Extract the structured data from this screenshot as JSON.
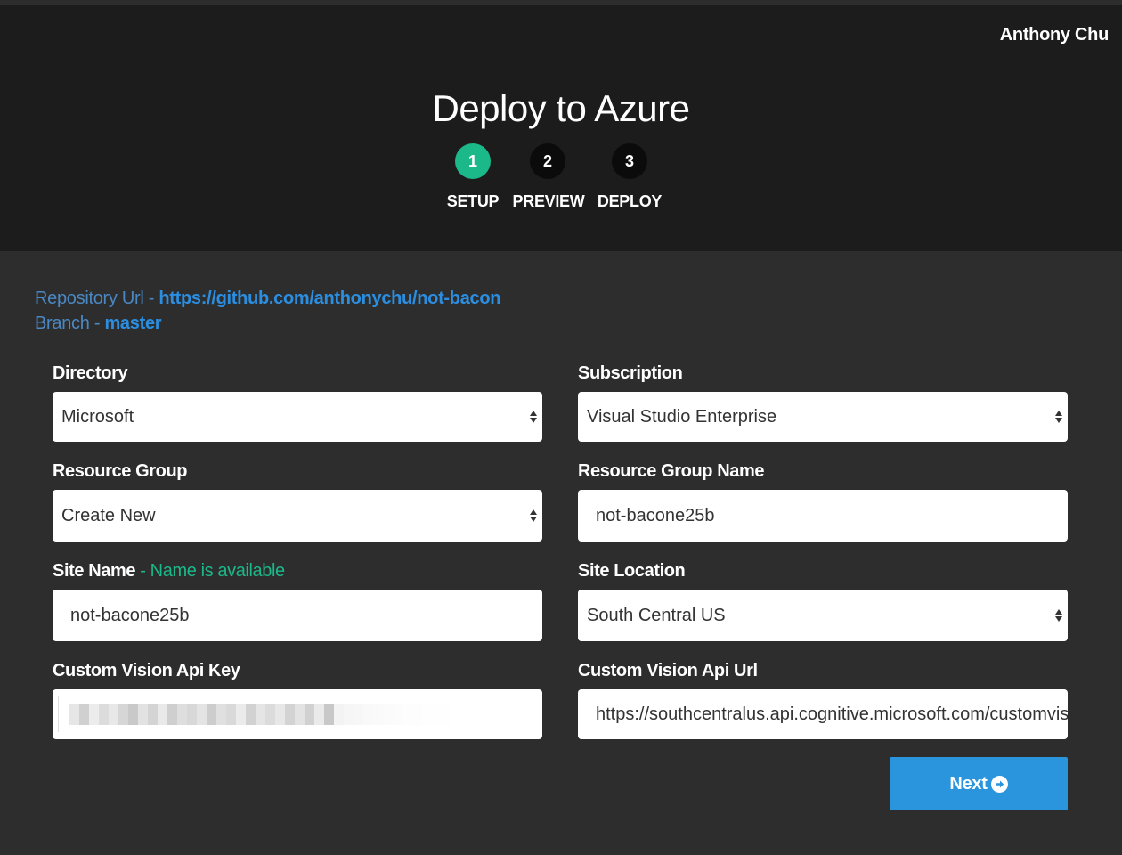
{
  "header": {
    "user_name": "Anthony Chu",
    "title": "Deploy to Azure",
    "steps": [
      {
        "number": "1",
        "label": "SETUP",
        "active": true
      },
      {
        "number": "2",
        "label": "PREVIEW",
        "active": false
      },
      {
        "number": "3",
        "label": "DEPLOY",
        "active": false
      }
    ]
  },
  "repo": {
    "url_label": "Repository Url - ",
    "url_value": "https://github.com/anthonychu/not-bacon",
    "branch_label": "Branch - ",
    "branch_value": "master"
  },
  "form": {
    "directory": {
      "label": "Directory",
      "value": "Microsoft"
    },
    "subscription": {
      "label": "Subscription",
      "value": "Visual Studio Enterprise"
    },
    "resource_group": {
      "label": "Resource Group",
      "value": "Create New"
    },
    "resource_group_name": {
      "label": "Resource Group Name",
      "value": "not-bacone25b"
    },
    "site_name": {
      "label": "Site Name",
      "status": " - Name is available",
      "value": "not-bacone25b"
    },
    "site_location": {
      "label": "Site Location",
      "value": "South Central US"
    },
    "api_key": {
      "label": "Custom Vision Api Key",
      "value_masked": true
    },
    "api_url": {
      "label": "Custom Vision Api Url",
      "value": "https://southcentralus.api.cognitive.microsoft.com/customvision"
    }
  },
  "actions": {
    "next_label": "Next"
  },
  "icons": {
    "next": "arrow-circle-right-icon",
    "select": "select-arrows-icon"
  },
  "colors": {
    "header_bg": "#1c1c1c",
    "page_bg": "#2d2d2d",
    "accent_green": "#1bb889",
    "link_blue": "#2b8ee0",
    "button_blue": "#2a94dd"
  }
}
